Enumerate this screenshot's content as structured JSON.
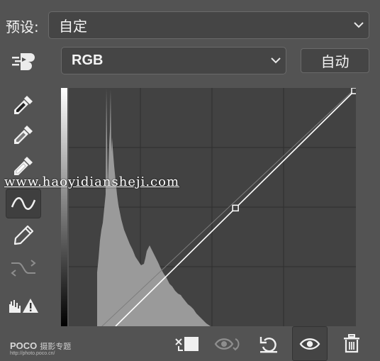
{
  "preset": {
    "label": "预设:",
    "value": "自定"
  },
  "channel": {
    "value": "RGB"
  },
  "auto_button": {
    "label": "自动"
  },
  "watermark": {
    "text": "www.haoyidiansheji.com"
  },
  "footer": {
    "brand": "POCO",
    "brand_sub": "摄影专题",
    "url": "http://photo.poco.cn/"
  },
  "tools": [
    "target-adjust-icon",
    "black-point-eyedropper-icon",
    "gray-point-eyedropper-icon",
    "white-point-eyedropper-icon",
    "curve-edit-icon",
    "pencil-draw-icon",
    "smooth-curve-icon",
    "clipping-warning-icon"
  ],
  "curve": {
    "points": [
      [
        0,
        0
      ],
      [
        128,
        128
      ],
      [
        255,
        255
      ]
    ],
    "input_range": [
      0,
      255
    ],
    "output_range": [
      0,
      255
    ]
  },
  "colors": {
    "panel_bg": "#535353",
    "graph_bg": "#424242",
    "histogram": "#9a9a9a",
    "curve": "#ffffff"
  }
}
